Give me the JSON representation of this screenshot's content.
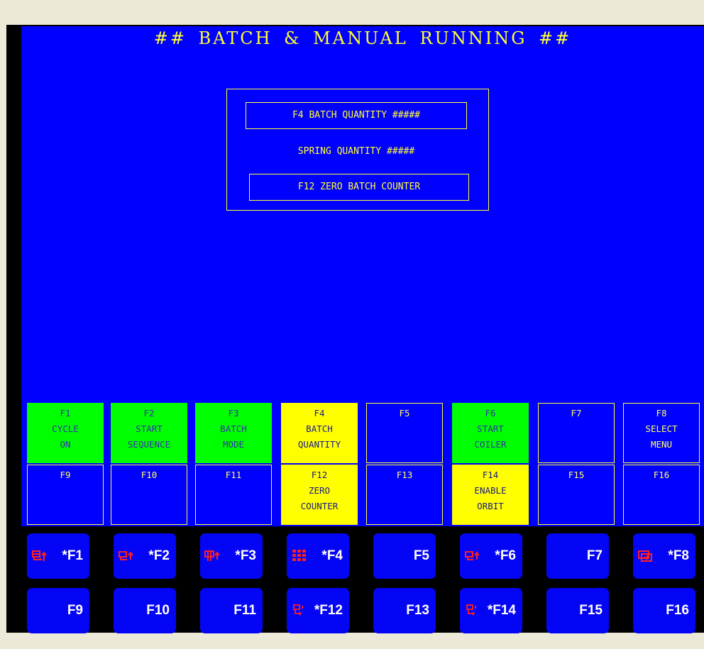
{
  "screen": {
    "title": "## BATCH & MANUAL RUNNING ##",
    "batch_quantity": "F4 BATCH QUANTITY #####",
    "spring_quantity": "SPRING QUANTITY #####",
    "zero_counter": "F12 ZERO BATCH COUNTER"
  },
  "fkeys_row1": [
    {
      "key": "F1",
      "l2": "CYCLE",
      "l3": "ON",
      "state": "green"
    },
    {
      "key": "F2",
      "l2": "START",
      "l3": "SEQUENCE",
      "state": "green"
    },
    {
      "key": "F3",
      "l2": "BATCH",
      "l3": "MODE",
      "state": "green"
    },
    {
      "key": "F4",
      "l2": "BATCH",
      "l3": "QUANTITY",
      "state": "yellow"
    },
    {
      "key": "F5",
      "l2": "",
      "l3": "",
      "state": "blue"
    },
    {
      "key": "F6",
      "l2": "START",
      "l3": "COILER",
      "state": "green"
    },
    {
      "key": "F7",
      "l2": "",
      "l3": "",
      "state": "blue"
    },
    {
      "key": "F8",
      "l2": "SELECT",
      "l3": "MENU",
      "state": "blue"
    }
  ],
  "fkeys_row2": [
    {
      "key": "F9",
      "l2": "",
      "l3": "",
      "state": "blue"
    },
    {
      "key": "F10",
      "l2": "",
      "l3": "",
      "state": "blue"
    },
    {
      "key": "F11",
      "l2": "",
      "l3": "",
      "state": "blue"
    },
    {
      "key": "F12",
      "l2": "ZERO",
      "l3": "COUNTER",
      "state": "yellow"
    },
    {
      "key": "F13",
      "l2": "",
      "l3": "",
      "state": "blue"
    },
    {
      "key": "F14",
      "l2": "ENABLE",
      "l3": "ORBIT",
      "state": "yellow"
    },
    {
      "key": "F15",
      "l2": "",
      "l3": "",
      "state": "blue"
    },
    {
      "key": "F16",
      "l2": "",
      "l3": "",
      "state": "blue"
    }
  ],
  "buttons_row1": [
    {
      "label": "*F1",
      "icon": "cycle-icon"
    },
    {
      "label": "*F2",
      "icon": "sequence-icon"
    },
    {
      "label": "*F3",
      "icon": "mode-icon"
    },
    {
      "label": "*F4",
      "icon": "keypad-icon"
    },
    {
      "label": "F5",
      "icon": ""
    },
    {
      "label": "*F6",
      "icon": "coiler-icon"
    },
    {
      "label": "F7",
      "icon": ""
    },
    {
      "label": "*F8",
      "icon": "menu-icon"
    }
  ],
  "buttons_row2": [
    {
      "label": "F9",
      "icon": ""
    },
    {
      "label": "F10",
      "icon": ""
    },
    {
      "label": "F11",
      "icon": ""
    },
    {
      "label": "*F12",
      "icon": "reset-icon"
    },
    {
      "label": "F13",
      "icon": ""
    },
    {
      "label": "*F14",
      "icon": "enable-icon"
    },
    {
      "label": "F15",
      "icon": ""
    },
    {
      "label": "F16",
      "icon": ""
    }
  ],
  "colors": {
    "screen_bg": "#0000fe",
    "text_yellow": "#ffff33",
    "active_green": "#00ff00",
    "active_yellow": "#ffff00",
    "button_blue": "#0505f5",
    "icon_red": "#ff2020"
  }
}
